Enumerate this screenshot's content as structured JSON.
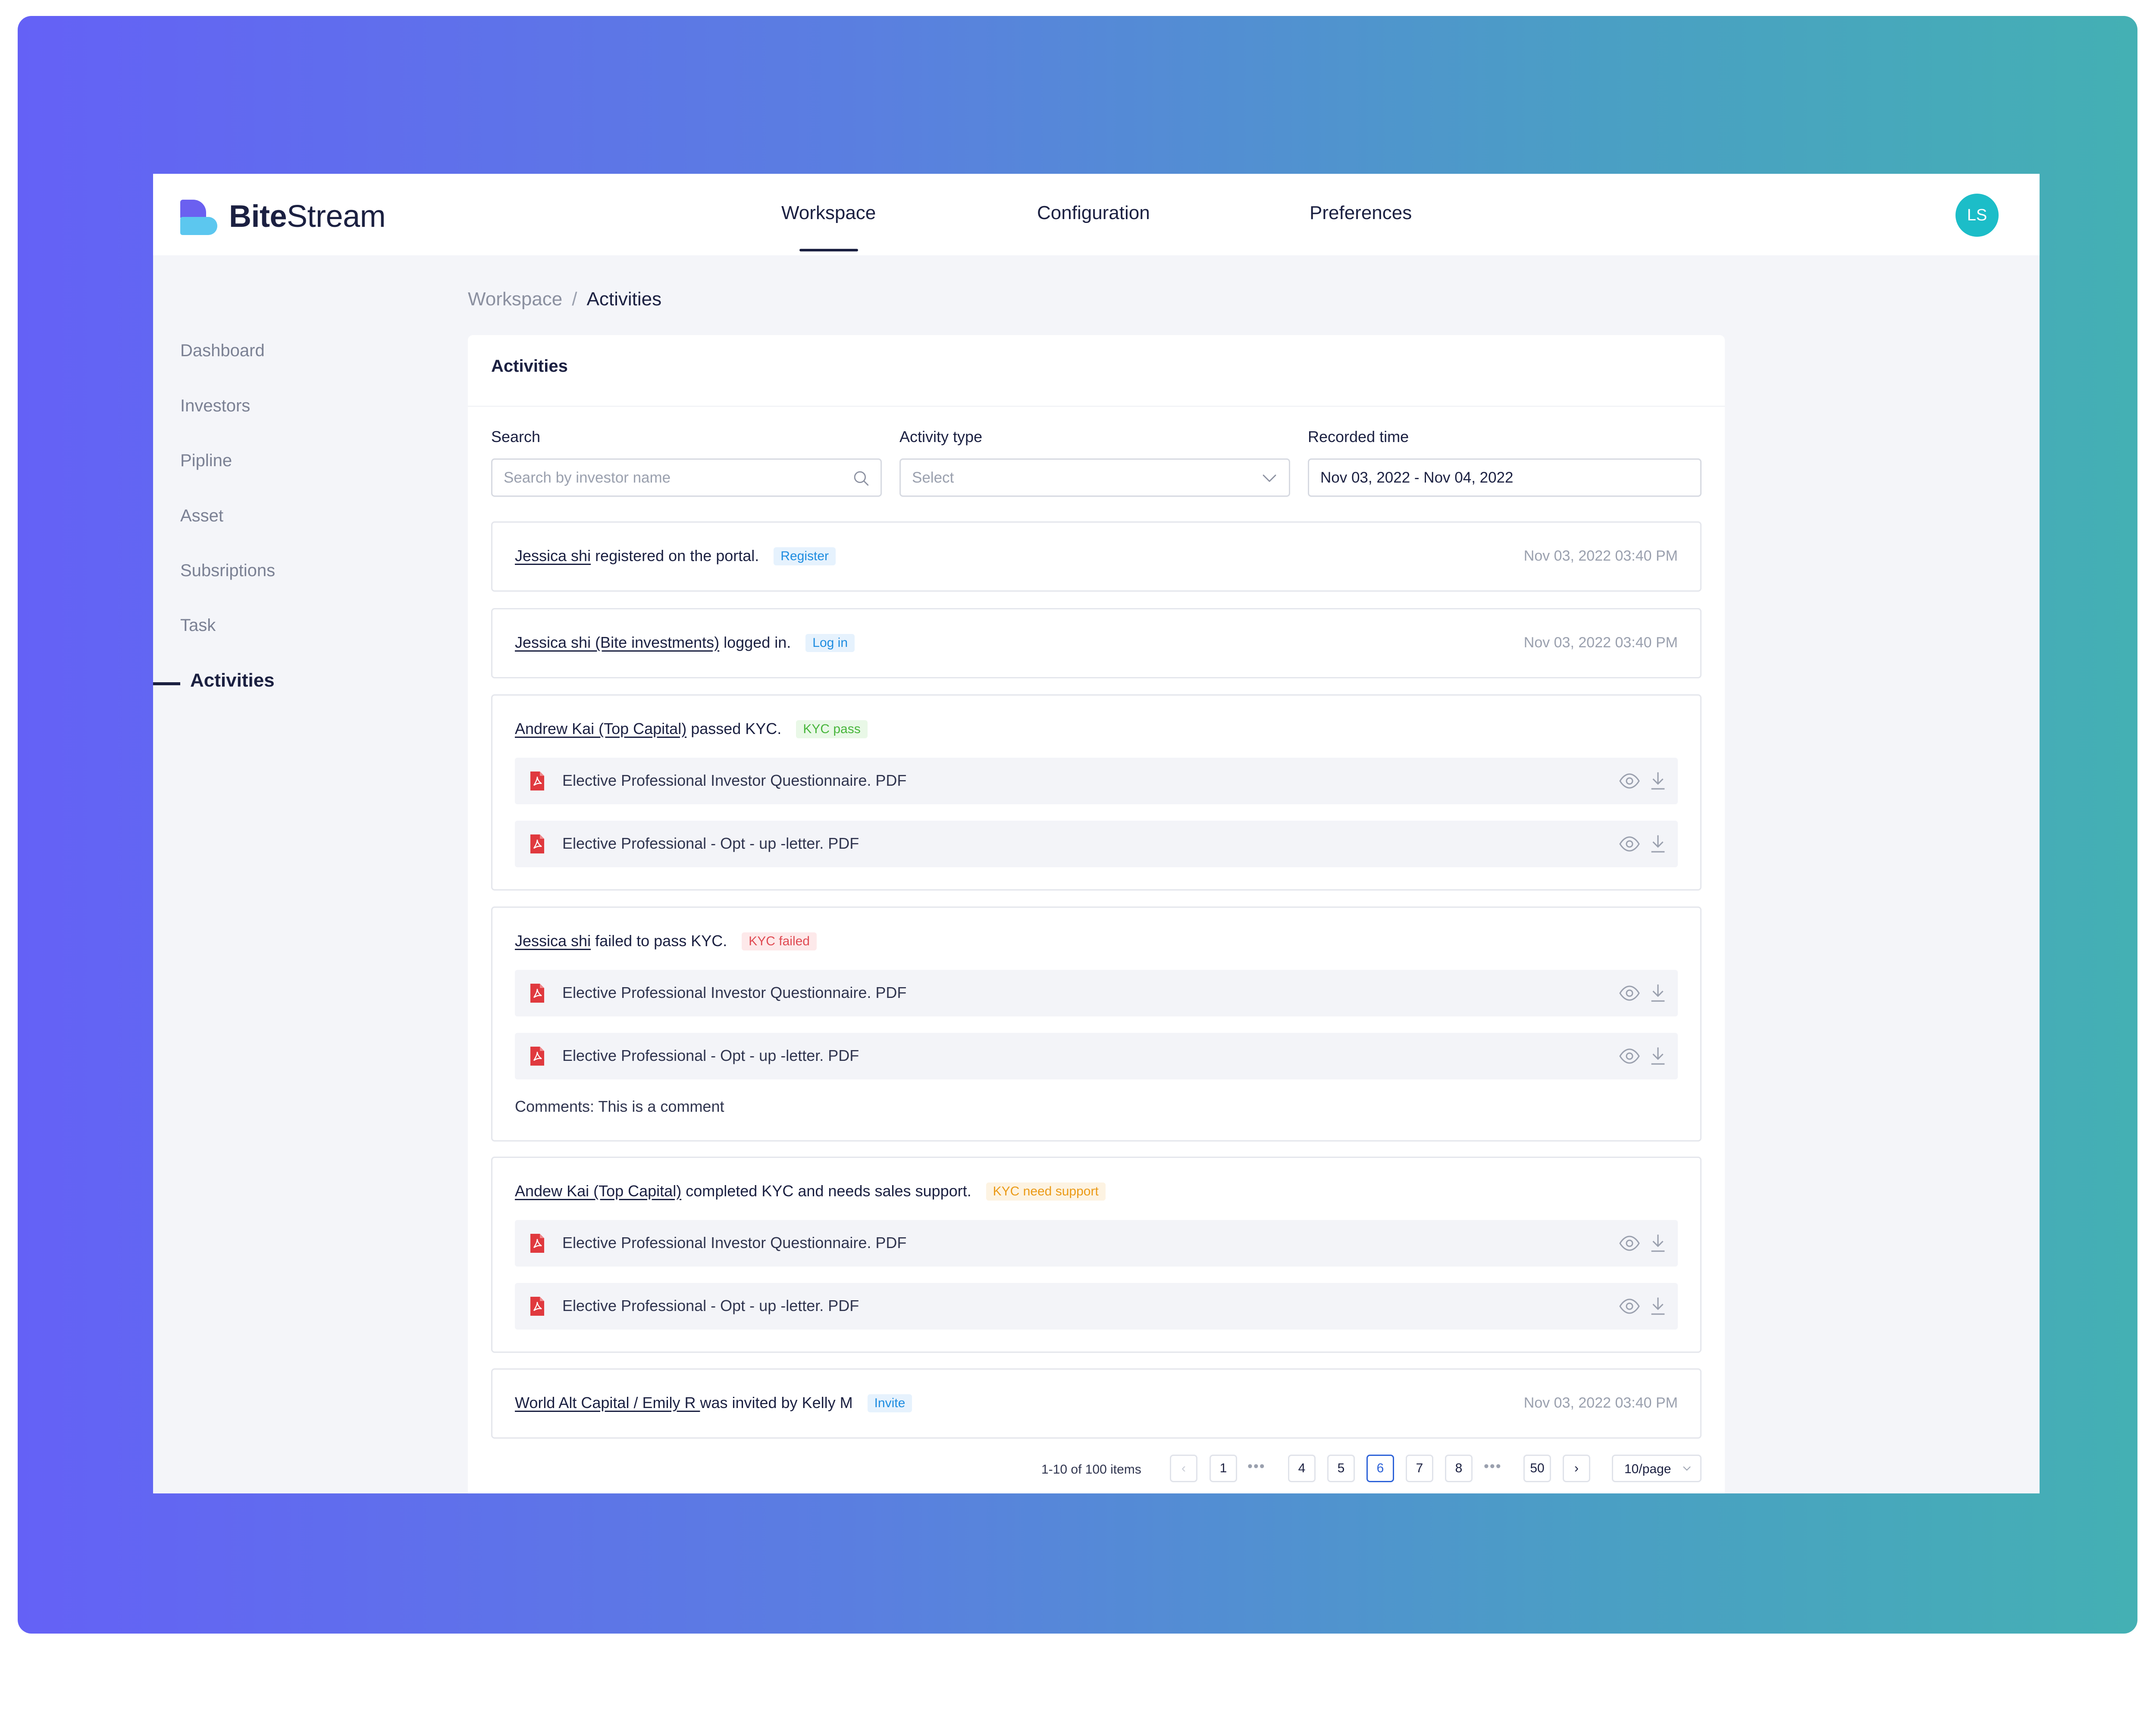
{
  "brand": {
    "name_bold": "Bite",
    "name_rest": "Stream"
  },
  "nav": [
    {
      "label": "Workspace"
    },
    {
      "label": "Configuration"
    },
    {
      "label": "Preferences"
    }
  ],
  "avatar": {
    "initials": "LS",
    "color": "#1cbdc8"
  },
  "sidebar": {
    "items": [
      {
        "label": "Dashboard"
      },
      {
        "label": "Investors"
      },
      {
        "label": "Pipline"
      },
      {
        "label": "Asset"
      },
      {
        "label": "Subsriptions"
      },
      {
        "label": "Task"
      },
      {
        "label": "Activities"
      }
    ]
  },
  "breadcrumb": {
    "parent": "Workspace",
    "separator": "/",
    "current": "Activities"
  },
  "panel": {
    "title": "Activities"
  },
  "filters": {
    "search": {
      "label": "Search",
      "placeholder": "Search by investor name"
    },
    "activity_type": {
      "label": "Activity type",
      "placeholder": "Select"
    },
    "recorded_time": {
      "label": "Recorded time",
      "value": "Nov 03, 2022 - Nov 04, 2022"
    }
  },
  "activities": [
    {
      "actor": "Jessica shi",
      "text": " registered on the portal.",
      "tag": "Register",
      "time": "Nov 03, 2022 03:40 PM"
    },
    {
      "actor": "Jessica shi (Bite investments)",
      "text": " logged in.",
      "tag": "Log in",
      "time": "Nov 03, 2022 03:40 PM"
    },
    {
      "actor": "Andrew Kai (Top Capital)",
      "text": "  passed KYC.",
      "tag": "KYC pass",
      "files": [
        "Elective Professional Investor Questionnaire. PDF",
        "Elective Professional - Opt - up -letter. PDF"
      ]
    },
    {
      "actor": "Jessica shi",
      "text": " failed to pass KYC.",
      "tag": "KYC failed",
      "files": [
        "Elective Professional Investor Questionnaire. PDF",
        "Elective Professional - Opt - up -letter. PDF"
      ],
      "comment": "Comments: This is a comment"
    },
    {
      "actor": "Andew Kai (Top Capital)",
      "text": " completed KYC and needs sales support.",
      "tag": "KYC need support",
      "files": [
        "Elective Professional Investor Questionnaire. PDF",
        "Elective Professional - Opt - up -letter. PDF"
      ]
    },
    {
      "actor": "World Alt Capital / Emily R ",
      "text": " was invited by Kelly M",
      "tag": "Invite",
      "time": "Nov 03, 2022 03:40 PM"
    }
  ],
  "pagination": {
    "total": "1-10 of 100 items",
    "prev": "‹",
    "next": "›",
    "ellipsis": "•••",
    "pages": [
      "1",
      "4",
      "5",
      "6",
      "7",
      "8",
      "50"
    ],
    "current": "6",
    "page_size": "10/page"
  },
  "colors": {
    "accent": "#2d62d8",
    "brand_purple": "#6b60f0",
    "brand_cyan": "#5cc7ef",
    "tag_register": "#1d8ce0",
    "tag_pass": "#47b53b",
    "tag_failed": "#e04a52",
    "tag_support": "#eb9a16"
  },
  "icons": {
    "search": "search-icon",
    "dropdown": "chevron-down-icon",
    "file": "pdf-file-icon",
    "preview": "eye-icon",
    "download": "download-icon"
  }
}
